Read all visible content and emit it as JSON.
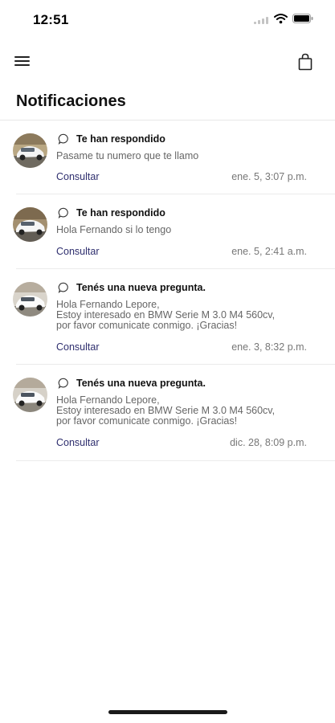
{
  "status_bar": {
    "time": "12:51"
  },
  "header": {
    "title": "Notificaciones"
  },
  "notifications": [
    {
      "title": "Te han respondido",
      "lines": [
        "Pasame tu numero que te llamo"
      ],
      "action": "Consultar",
      "date": "ene. 5, 3:07 p.m.",
      "icon": "chat-bubble-icon"
    },
    {
      "title": "Te han respondido",
      "lines": [
        "Hola Fernando si lo tengo"
      ],
      "action": "Consultar",
      "date": "ene. 5, 2:41 a.m.",
      "icon": "chat-bubble-icon"
    },
    {
      "title": "Tenés una nueva pregunta.",
      "lines": [
        "Hola Fernando Lepore,",
        "Estoy interesado en BMW Serie M 3.0 M4 560cv,",
        "por favor comunicate conmigo. ¡Gracias!"
      ],
      "action": "Consultar",
      "date": "ene. 3, 8:32 p.m.",
      "icon": "chat-bubble-icon"
    },
    {
      "title": "Tenés una nueva pregunta.",
      "lines": [
        "Hola Fernando Lepore,",
        "Estoy interesado en BMW Serie M 3.0 M4 560cv,",
        "por favor comunicate conmigo. ¡Gracias!"
      ],
      "action": "Consultar",
      "date": "dic. 28, 8:09 p.m.",
      "icon": "chat-bubble-icon"
    }
  ],
  "colors": {
    "action": "#2e2e6e",
    "title": "#111111",
    "muted": "#666666",
    "divider": "#ebebeb"
  }
}
